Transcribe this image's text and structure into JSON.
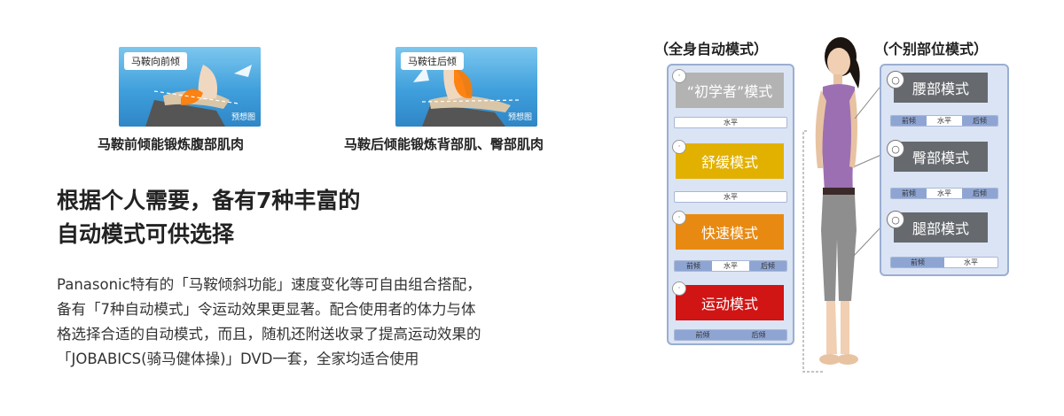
{
  "illustrations": [
    {
      "tag": "马鞍向前倾",
      "note": "预想图",
      "caption": "马鞍前倾能锻炼腹部肌肉"
    },
    {
      "tag": "马鞍往后倾",
      "note": "预想图",
      "caption": "马鞍后倾能锻炼背部肌、臀部肌肉"
    }
  ],
  "heading": {
    "line1": "根据个人需要，备有7种丰富的",
    "line2": "自动模式可供选择"
  },
  "body": {
    "line1": "Panasonic特有的「马鞍倾斜功能」速度变化等可自由组合搭配，",
    "line2": "备有「7种自动模式」令运动效果更显著。配合使用者的体力与体",
    "line3": "格选择合适的自动模式，而且，随机还附送收录了提高运动效果的",
    "line4": "「JOBABICS(骑马健体操)」DVD一套，全家均适合使用"
  },
  "full_body": {
    "title": "（全身自动模式）",
    "modes": [
      {
        "label": "“初学者”模式",
        "color": "#b3b3b3",
        "face": "·",
        "bar": [
          "水平"
        ]
      },
      {
        "label": "舒缓模式",
        "color": "#e2b100",
        "face": "·",
        "bar": [
          "水平"
        ]
      },
      {
        "label": "快速模式",
        "color": "#e88a12",
        "face": "·",
        "bar": [
          "前倾",
          "水平",
          "后倾"
        ]
      },
      {
        "label": "运动模式",
        "color": "#d11414",
        "face": "·",
        "bar": [
          "前倾",
          "后倾"
        ]
      }
    ]
  },
  "partial": {
    "title": "（个别部位模式）",
    "modes": [
      {
        "label": "腰部模式",
        "bar": [
          "前倾",
          "水平",
          "后倾"
        ]
      },
      {
        "label": "臀部模式",
        "bar": [
          "前倾",
          "水平",
          "后倾"
        ]
      },
      {
        "label": "腿部模式",
        "bar": [
          "前倾",
          "水平"
        ]
      }
    ]
  },
  "colors": {
    "panel_bg": "#dbe4f4",
    "panel_border": "#9aaed2",
    "bar_fill": "#8ea5d3"
  }
}
